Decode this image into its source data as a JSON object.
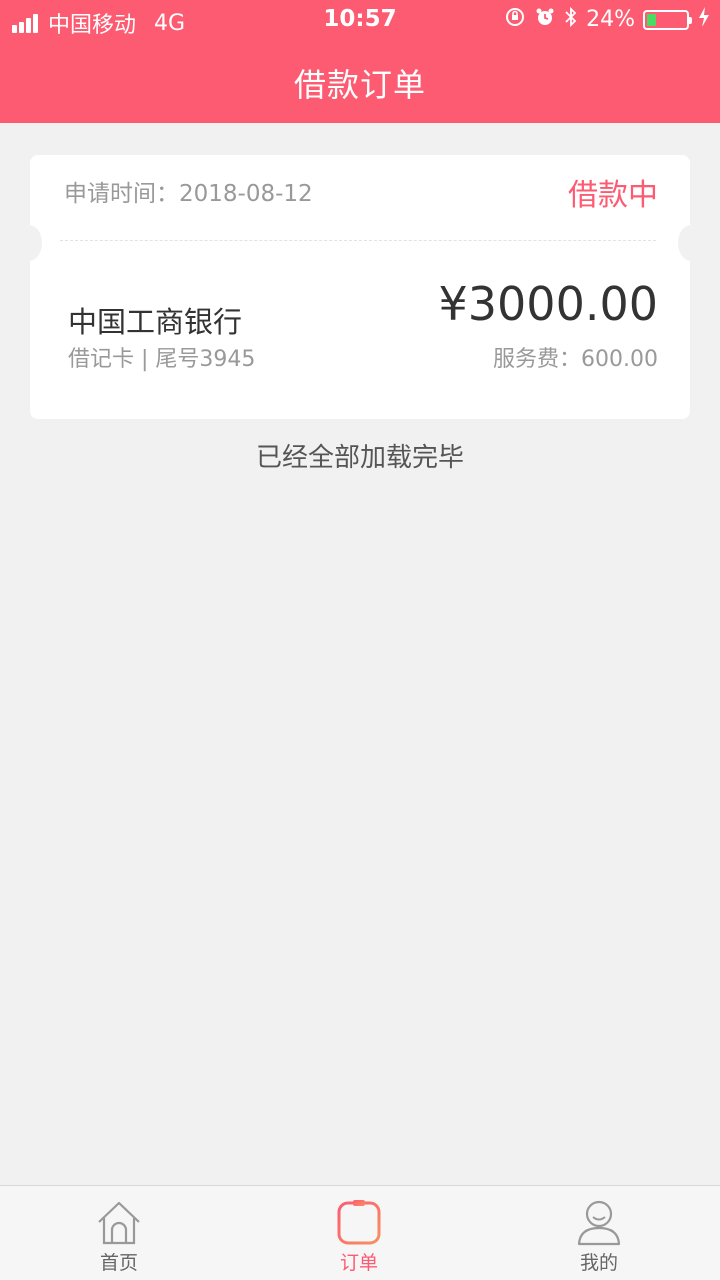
{
  "status_bar": {
    "carrier": "中国移动",
    "network": "4G",
    "time": "10:57",
    "battery": "24%",
    "battery_level": 0.24
  },
  "header": {
    "title": "借款订单"
  },
  "order": {
    "apply_time_label": "申请时间：",
    "apply_date": "2018-08-12",
    "status": "借款中",
    "bank_name": "中国工商银行",
    "card_info": "借记卡 | 尾号3945",
    "amount": "¥3000.00",
    "fee_label": "服务费：",
    "fee": "600.00"
  },
  "list_footer": "已经全部加载完毕",
  "tabbar": {
    "items": [
      {
        "label": "首页",
        "icon": "home-icon",
        "active": false
      },
      {
        "label": "订单",
        "icon": "order-list-icon",
        "active": true
      },
      {
        "label": "我的",
        "icon": "user-icon",
        "active": false
      }
    ]
  },
  "colors": {
    "brand": "#fd5b72",
    "background": "#f1f1f1",
    "battery_fill": "#4cd964"
  }
}
